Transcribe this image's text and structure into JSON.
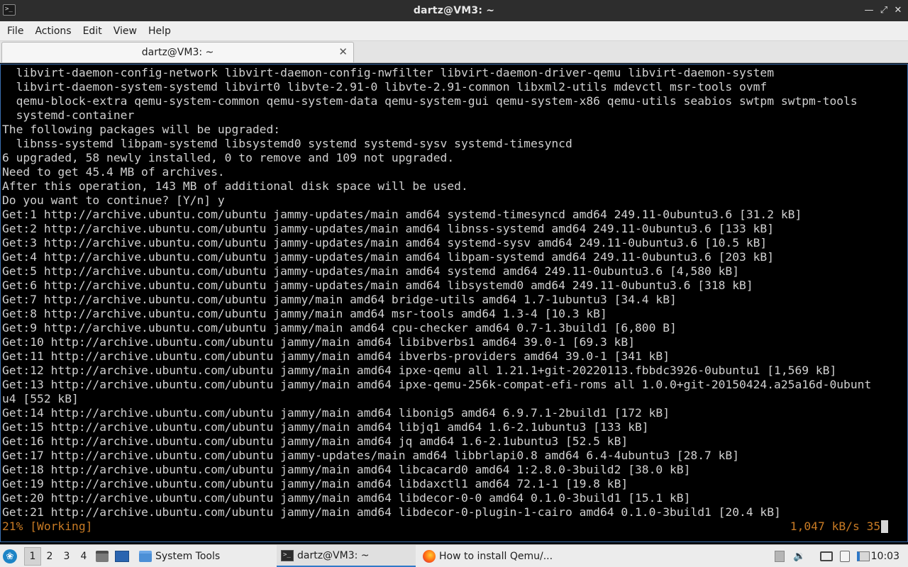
{
  "window": {
    "title": "dartz@VM3: ~",
    "app_icon": "terminal-icon",
    "controls": [
      "minimize-icon",
      "maximize-icon",
      "close-icon"
    ]
  },
  "menubar": {
    "items": [
      "File",
      "Actions",
      "Edit",
      "View",
      "Help"
    ]
  },
  "tabs": [
    {
      "label": "dartz@VM3: ~",
      "close": "✕"
    }
  ],
  "terminal": {
    "lines": [
      "  libvirt-daemon-config-network libvirt-daemon-config-nwfilter libvirt-daemon-driver-qemu libvirt-daemon-system",
      "  libvirt-daemon-system-systemd libvirt0 libvte-2.91-0 libvte-2.91-common libxml2-utils mdevctl msr-tools ovmf",
      "  qemu-block-extra qemu-system-common qemu-system-data qemu-system-gui qemu-system-x86 qemu-utils seabios swtpm swtpm-tools",
      "  systemd-container",
      "The following packages will be upgraded:",
      "  libnss-systemd libpam-systemd libsystemd0 systemd systemd-sysv systemd-timesyncd",
      "6 upgraded, 58 newly installed, 0 to remove and 109 not upgraded.",
      "Need to get 45.4 MB of archives.",
      "After this operation, 143 MB of additional disk space will be used.",
      "Do you want to continue? [Y/n] y",
      "Get:1 http://archive.ubuntu.com/ubuntu jammy-updates/main amd64 systemd-timesyncd amd64 249.11-0ubuntu3.6 [31.2 kB]",
      "Get:2 http://archive.ubuntu.com/ubuntu jammy-updates/main amd64 libnss-systemd amd64 249.11-0ubuntu3.6 [133 kB]",
      "Get:3 http://archive.ubuntu.com/ubuntu jammy-updates/main amd64 systemd-sysv amd64 249.11-0ubuntu3.6 [10.5 kB]",
      "Get:4 http://archive.ubuntu.com/ubuntu jammy-updates/main amd64 libpam-systemd amd64 249.11-0ubuntu3.6 [203 kB]",
      "Get:5 http://archive.ubuntu.com/ubuntu jammy-updates/main amd64 systemd amd64 249.11-0ubuntu3.6 [4,580 kB]",
      "Get:6 http://archive.ubuntu.com/ubuntu jammy-updates/main amd64 libsystemd0 amd64 249.11-0ubuntu3.6 [318 kB]",
      "Get:7 http://archive.ubuntu.com/ubuntu jammy/main amd64 bridge-utils amd64 1.7-1ubuntu3 [34.4 kB]",
      "Get:8 http://archive.ubuntu.com/ubuntu jammy/main amd64 msr-tools amd64 1.3-4 [10.3 kB]",
      "Get:9 http://archive.ubuntu.com/ubuntu jammy/main amd64 cpu-checker amd64 0.7-1.3build1 [6,800 B]",
      "Get:10 http://archive.ubuntu.com/ubuntu jammy/main amd64 libibverbs1 amd64 39.0-1 [69.3 kB]",
      "Get:11 http://archive.ubuntu.com/ubuntu jammy/main amd64 ibverbs-providers amd64 39.0-1 [341 kB]",
      "Get:12 http://archive.ubuntu.com/ubuntu jammy/main amd64 ipxe-qemu all 1.21.1+git-20220113.fbbdc3926-0ubuntu1 [1,569 kB]",
      "Get:13 http://archive.ubuntu.com/ubuntu jammy/main amd64 ipxe-qemu-256k-compat-efi-roms all 1.0.0+git-20150424.a25a16d-0ubunt",
      "u4 [552 kB]",
      "Get:14 http://archive.ubuntu.com/ubuntu jammy/main amd64 libonig5 amd64 6.9.7.1-2build1 [172 kB]",
      "Get:15 http://archive.ubuntu.com/ubuntu jammy/main amd64 libjq1 amd64 1.6-2.1ubuntu3 [133 kB]",
      "Get:16 http://archive.ubuntu.com/ubuntu jammy/main amd64 jq amd64 1.6-2.1ubuntu3 [52.5 kB]",
      "Get:17 http://archive.ubuntu.com/ubuntu jammy-updates/main amd64 libbrlapi0.8 amd64 6.4-4ubuntu3 [28.7 kB]",
      "Get:18 http://archive.ubuntu.com/ubuntu jammy/main amd64 libcacard0 amd64 1:2.8.0-3build2 [38.0 kB]",
      "Get:19 http://archive.ubuntu.com/ubuntu jammy/main amd64 libdaxctl1 amd64 72.1-1 [19.8 kB]",
      "Get:20 http://archive.ubuntu.com/ubuntu jammy/main amd64 libdecor-0-0 amd64 0.1.0-3build1 [15.1 kB]",
      "Get:21 http://archive.ubuntu.com/ubuntu jammy/main amd64 libdecor-0-plugin-1-cairo amd64 0.1.0-3build1 [20.4 kB]"
    ],
    "status_left": "21% [Working]",
    "status_right": "1,047 kB/s 35s",
    "status_color": "#c77a24"
  },
  "taskbar": {
    "start_icon": "lxqt-menu-icon",
    "workspaces": [
      "1",
      "2",
      "3",
      "4"
    ],
    "active_workspace": "1",
    "launchers": [
      "show-desktop-icon",
      "window-icon"
    ],
    "tasks": [
      {
        "label": "System Tools",
        "icon": "folder-icon"
      },
      {
        "label": "dartz@VM3: ~",
        "icon": "terminal-icon",
        "active": true
      },
      {
        "label": "How to install Qemu/...",
        "icon": "firefox-icon"
      }
    ],
    "tray": [
      "update-icon",
      "volume-icon",
      "monitor-icon",
      "clipboard-icon",
      "network-icon"
    ],
    "clock": "10:03"
  }
}
